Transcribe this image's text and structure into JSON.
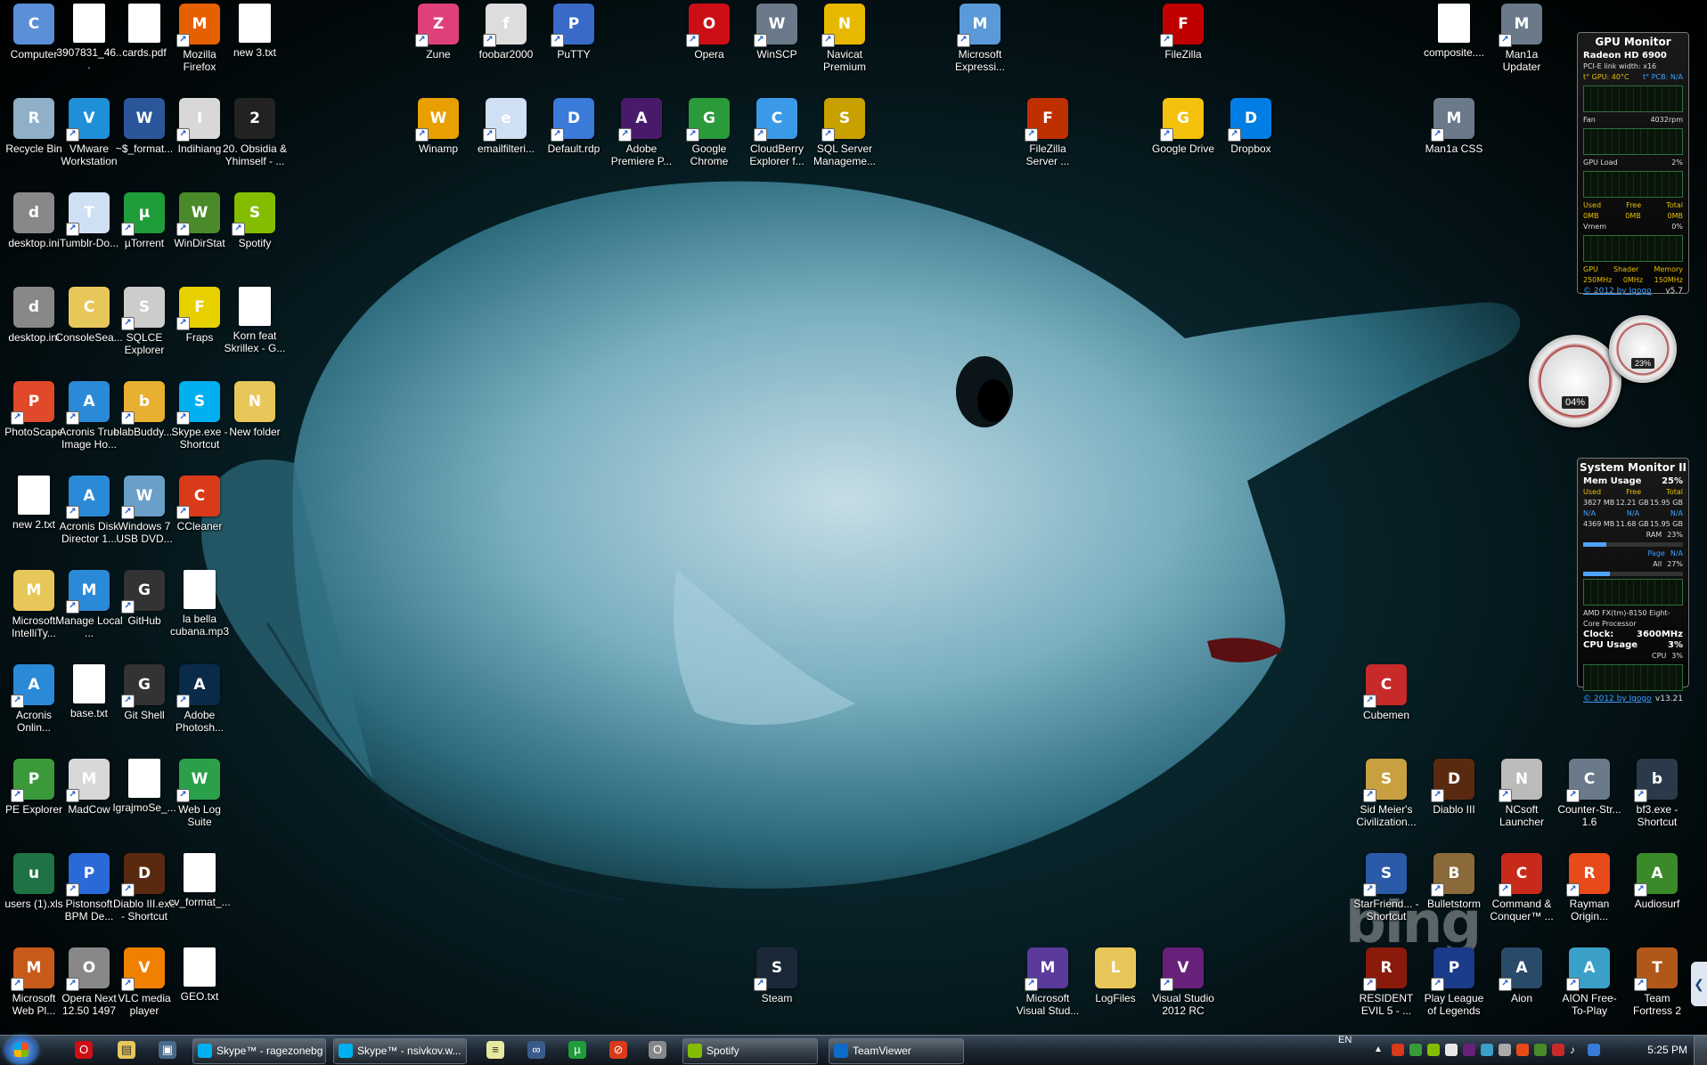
{
  "desktop_icons": [
    {
      "label": "Computer",
      "icon": "computer-icon",
      "color": "#5b8fd8",
      "shortcut": false
    },
    {
      "label": "3907831_46...",
      "icon": "file-icon",
      "color": "#ffffff",
      "shortcut": false
    },
    {
      "label": "cards.pdf",
      "icon": "pdf-icon",
      "color": "#ffffff",
      "shortcut": false
    },
    {
      "label": "Mozilla Firefox",
      "icon": "firefox-icon",
      "color": "#e66000",
      "shortcut": true
    },
    {
      "label": "new 3.txt",
      "icon": "text-file-icon",
      "color": "#ffffff",
      "shortcut": false
    },
    {
      "label": "Recycle Bin",
      "icon": "recycle-bin-icon",
      "color": "#8fb0c8",
      "shortcut": false
    },
    {
      "label": "VMware Workstation",
      "icon": "vmware-icon",
      "color": "#1f8fd8",
      "shortcut": true
    },
    {
      "label": "~$_format...",
      "icon": "word-doc-icon",
      "color": "#2b579a",
      "shortcut": false
    },
    {
      "label": "Indihiang",
      "icon": "chart-app-icon",
      "color": "#d8d8d8",
      "shortcut": true
    },
    {
      "label": "20. Obsidia & Yhimself - ...",
      "icon": "image-file-icon",
      "color": "#222222",
      "shortcut": false
    },
    {
      "label": "desktop.ini",
      "icon": "settings-file-icon",
      "color": "#888888",
      "shortcut": false
    },
    {
      "label": "Tumblr-Do...",
      "icon": "window-app-icon",
      "color": "#cfe0f5",
      "shortcut": true
    },
    {
      "label": "µTorrent",
      "icon": "utorrent-icon",
      "color": "#1f9d3a",
      "shortcut": true
    },
    {
      "label": "WinDirStat",
      "icon": "tree-icon",
      "color": "#4a8a2a",
      "shortcut": true
    },
    {
      "label": "Spotify",
      "icon": "spotify-icon",
      "color": "#84bd00",
      "shortcut": true
    },
    {
      "label": "desktop.ini",
      "icon": "settings-file-icon",
      "color": "#888888",
      "shortcut": false
    },
    {
      "label": "ConsoleSea...",
      "icon": "folder-icon",
      "color": "#e8c75a",
      "shortcut": false
    },
    {
      "label": "SQLCE Explorer",
      "icon": "database-icon",
      "color": "#cccccc",
      "shortcut": true
    },
    {
      "label": "Fraps",
      "icon": "fraps-icon",
      "color": "#e8d000",
      "shortcut": true
    },
    {
      "label": "Korn feat Skrillex - G...",
      "icon": "mp3-file-icon",
      "color": "#ffffff",
      "shortcut": false
    },
    {
      "label": "PhotoScape",
      "icon": "photoscape-icon",
      "color": "#e04a2a",
      "shortcut": true
    },
    {
      "label": "Acronis True Image Ho...",
      "icon": "acronis-icon",
      "color": "#2a8ad8",
      "shortcut": true
    },
    {
      "label": "blabBuddy....",
      "icon": "app-icon",
      "color": "#e8b030",
      "shortcut": true
    },
    {
      "label": "Skype.exe - Shortcut",
      "icon": "skype-icon",
      "color": "#00aff0",
      "shortcut": true
    },
    {
      "label": "New folder",
      "icon": "folder-icon",
      "color": "#e8c75a",
      "shortcut": false
    },
    {
      "label": "new 2.txt",
      "icon": "text-file-icon",
      "color": "#ffffff",
      "shortcut": false
    },
    {
      "label": "Acronis Disk Director 1...",
      "icon": "acronis-icon",
      "color": "#2a8ad8",
      "shortcut": true
    },
    {
      "label": "Windows 7 USB DVD...",
      "icon": "usb-tool-icon",
      "color": "#6aa0c8",
      "shortcut": true
    },
    {
      "label": "CCleaner",
      "icon": "ccleaner-icon",
      "color": "#d83a1a",
      "shortcut": true
    },
    {
      "label": "Microsoft IntelliTy...",
      "icon": "folder-icon",
      "color": "#e8c75a",
      "shortcut": false
    },
    {
      "label": "Manage Local ...",
      "icon": "acronis-icon",
      "color": "#2a8ad8",
      "shortcut": true
    },
    {
      "label": "GitHub",
      "icon": "github-icon",
      "color": "#333333",
      "shortcut": true
    },
    {
      "label": "la bella cubana.mp3",
      "icon": "mp3-file-icon",
      "color": "#ffffff",
      "shortcut": false
    },
    {
      "label": "Acronis Onlin...",
      "icon": "acronis-icon",
      "color": "#2a8ad8",
      "shortcut": true
    },
    {
      "label": "base.txt",
      "icon": "text-file-icon",
      "color": "#ffffff",
      "shortcut": false
    },
    {
      "label": "Git Shell",
      "icon": "github-icon",
      "color": "#333333",
      "shortcut": true
    },
    {
      "label": "Adobe Photosh...",
      "icon": "photoshop-icon",
      "color": "#0a2a4a",
      "shortcut": true
    },
    {
      "label": "PE Explorer",
      "icon": "pe-explorer-icon",
      "color": "#3a9a3a",
      "shortcut": true
    },
    {
      "label": "MadCow",
      "icon": "app-window-icon",
      "color": "#d8d8d8",
      "shortcut": true
    },
    {
      "label": "IgrajmoSe_...",
      "icon": "image-file-icon",
      "color": "#ffffff",
      "shortcut": false
    },
    {
      "label": "Web Log Suite",
      "icon": "web-log-icon",
      "color": "#2aa04a",
      "shortcut": true
    },
    {
      "label": "users (1).xls",
      "icon": "excel-file-icon",
      "color": "#1f7244",
      "shortcut": false
    },
    {
      "label": "Pistonsoft BPM De...",
      "icon": "bpm-icon",
      "color": "#2a6ad8",
      "shortcut": true
    },
    {
      "label": "Diablo III.exe - Shortcut",
      "icon": "diablo-icon",
      "color": "#5a2a10",
      "shortcut": true
    },
    {
      "label": "cv_format_...",
      "icon": "pdf-icon",
      "color": "#ffffff",
      "shortcut": false
    },
    {
      "label": "Microsoft Web Pl...",
      "icon": "web-platform-icon",
      "color": "#c85a1a",
      "shortcut": true
    },
    {
      "label": "Opera Next 12.50 1497",
      "icon": "opera-next-icon",
      "color": "#888888",
      "shortcut": true
    },
    {
      "label": "VLC media player",
      "icon": "vlc-icon",
      "color": "#f08000",
      "shortcut": true
    },
    {
      "label": "GEO.txt",
      "icon": "text-file-icon",
      "color": "#ffffff",
      "shortcut": false
    },
    {
      "label": "Zune",
      "icon": "zune-icon",
      "color": "#e0407a",
      "shortcut": true
    },
    {
      "label": "foobar2000",
      "icon": "foobar-icon",
      "color": "#dddddd",
      "shortcut": true
    },
    {
      "label": "PuTTY",
      "icon": "putty-icon",
      "color": "#3a6ac8",
      "shortcut": true
    },
    {
      "label": "Opera",
      "icon": "opera-icon",
      "color": "#cc0f16",
      "shortcut": true
    },
    {
      "label": "WinSCP",
      "icon": "winscp-icon",
      "color": "#6a7a8a",
      "shortcut": true
    },
    {
      "label": "Navicat Premium",
      "icon": "navicat-icon",
      "color": "#e8b800",
      "shortcut": true
    },
    {
      "label": "Microsoft Expressi...",
      "icon": "expression-icon",
      "color": "#5a9ad8",
      "shortcut": true
    },
    {
      "label": "FileZilla",
      "icon": "filezilla-icon",
      "color": "#bf0000",
      "shortcut": true
    },
    {
      "label": "composite....",
      "icon": "text-file-icon",
      "color": "#ffffff",
      "shortcut": false
    },
    {
      "label": "Man1a Updater",
      "icon": "counter-strike-icon",
      "color": "#6a7a8a",
      "shortcut": true
    },
    {
      "label": "Winamp",
      "icon": "winamp-icon",
      "color": "#e8a000",
      "shortcut": true
    },
    {
      "label": "emailfilteri...",
      "icon": "window-app-icon",
      "color": "#cfe0f5",
      "shortcut": true
    },
    {
      "label": "Default.rdp",
      "icon": "remote-desktop-icon",
      "color": "#3a7ad8",
      "shortcut": true
    },
    {
      "label": "Adobe Premiere P...",
      "icon": "premiere-icon",
      "color": "#4a1a6a",
      "shortcut": true
    },
    {
      "label": "Google Chrome",
      "icon": "chrome-icon",
      "color": "#2a9a3a",
      "shortcut": true
    },
    {
      "label": "CloudBerry Explorer f...",
      "icon": "cloudberry-icon",
      "color": "#3a9ae8",
      "shortcut": true
    },
    {
      "label": "SQL Server Manageme...",
      "icon": "sql-server-icon",
      "color": "#c8a000",
      "shortcut": true
    },
    {
      "label": "FileZilla Server ...",
      "icon": "filezilla-server-icon",
      "color": "#bf3000",
      "shortcut": true
    },
    {
      "label": "Google Drive",
      "icon": "google-drive-icon",
      "color": "#f4c20d",
      "shortcut": true
    },
    {
      "label": "Dropbox",
      "icon": "dropbox-icon",
      "color": "#007ee5",
      "shortcut": true
    },
    {
      "label": "Man1a CSS",
      "icon": "counter-strike-icon",
      "color": "#6a7a8a",
      "shortcut": true
    },
    {
      "label": "Cubemen",
      "icon": "cubemen-icon",
      "color": "#c82a2a",
      "shortcut": true
    },
    {
      "label": "Sid Meier's Civilization...",
      "icon": "civilization-icon",
      "color": "#c8a040",
      "shortcut": true
    },
    {
      "label": "Diablo III",
      "icon": "diablo-icon",
      "color": "#5a2a10",
      "shortcut": true
    },
    {
      "label": "NCsoft Launcher",
      "icon": "ncsoft-icon",
      "color": "#bbbbbb",
      "shortcut": true
    },
    {
      "label": "Counter-Str... 1.6",
      "icon": "counter-strike-icon",
      "color": "#6a7a8a",
      "shortcut": true
    },
    {
      "label": "bf3.exe - Shortcut",
      "icon": "battlefield-icon",
      "color": "#2a3a4a",
      "shortcut": true
    },
    {
      "label": "StarFriend... - Shortcut",
      "icon": "starfriend-icon",
      "color": "#2a5aa8",
      "shortcut": true
    },
    {
      "label": "Bulletstorm",
      "icon": "bulletstorm-icon",
      "color": "#8a6a3a",
      "shortcut": true
    },
    {
      "label": "Command & Conquer™ ...",
      "icon": "command-conquer-icon",
      "color": "#c82a1a",
      "shortcut": true
    },
    {
      "label": "Rayman Origin...",
      "icon": "rayman-icon",
      "color": "#e84a1a",
      "shortcut": true
    },
    {
      "label": "Audiosurf",
      "icon": "audiosurf-icon",
      "color": "#3a8a2a",
      "shortcut": true
    },
    {
      "label": "Steam",
      "icon": "steam-icon",
      "color": "#1b2838",
      "shortcut": true
    },
    {
      "label": "Microsoft Visual Stud...",
      "icon": "visual-studio-icon",
      "color": "#5a3a9a",
      "shortcut": true
    },
    {
      "label": "LogFiles",
      "icon": "folder-icon",
      "color": "#e8c75a",
      "shortcut": false
    },
    {
      "label": "Visual Studio 2012 RC",
      "icon": "visual-studio-icon",
      "color": "#68217a",
      "shortcut": true
    },
    {
      "label": "RESIDENT EVIL 5 - ...",
      "icon": "resident-evil-icon",
      "color": "#8a1a0a",
      "shortcut": true
    },
    {
      "label": "Play League of Legends",
      "icon": "league-icon",
      "color": "#1a3a8a",
      "shortcut": true
    },
    {
      "label": "Aion",
      "icon": "aion-icon",
      "color": "#2a4a6a",
      "shortcut": true
    },
    {
      "label": "AION Free-To-Play",
      "icon": "aion-icon",
      "color": "#3aa0c8",
      "shortcut": true
    },
    {
      "label": "Team Fortress 2",
      "icon": "tf2-icon",
      "color": "#b0581a",
      "shortcut": true
    }
  ],
  "gpu_monitor": {
    "title": "GPU Monitor",
    "card": "Radeon HD 6900",
    "pci": "PCI-E link width: x16",
    "temp_gpu": "t° GPU: 40°C",
    "temp_pcb": "t° PCB: N/A",
    "fan_label": "Fan",
    "fan_value": "4032rpm",
    "gpu_load_label": "GPU Load",
    "gpu_load_value": "2%",
    "mem_used_label": "Used",
    "mem_free_label": "Free",
    "mem_total_label": "Total",
    "mem_used": "0MB",
    "mem_free": "0MB",
    "mem_total": "0MB",
    "vmem_label": "Vmem",
    "vmem_value": "0%",
    "clock_gpu_label": "GPU",
    "clock_shader_label": "Shader",
    "clock_memory_label": "Memory",
    "clock_gpu": "250MHz",
    "clock_shader": "0MHz",
    "clock_memory": "150MHz",
    "link": "© 2012 by Igogo",
    "version": "v5.7"
  },
  "gauges": {
    "cpu_label": "04%",
    "mem_label": "23%"
  },
  "system_monitor": {
    "title": "System Monitor II",
    "mem_usage_label": "Mem Usage",
    "mem_usage_value": "25%",
    "col_used": "Used",
    "col_free": "Free",
    "col_total": "Total",
    "row1": [
      "3827 MB",
      "12.21 GB",
      "15.95 GB"
    ],
    "row2": [
      "N/A",
      "N/A",
      "N/A"
    ],
    "row3": [
      "4369 MB",
      "11.68 GB",
      "15.95 GB"
    ],
    "ram_label": "RAM",
    "ram_value": "23%",
    "page_label": "Page",
    "page_value": "N/A",
    "all_label": "All",
    "all_value": "27%",
    "cpu_name": "AMD FX(tm)-8150 Eight-Core Processor",
    "clock_label": "Clock:",
    "clock_value": "3600MHz",
    "cpu_usage_label": "CPU Usage",
    "cpu_usage_value": "3%",
    "cpu_label": "CPU",
    "cpu_value": "3%",
    "link": "© 2012 by Igogo",
    "version": "v13.21"
  },
  "watermark": "bing",
  "taskbar": {
    "windows": [
      {
        "label": "Skype™ - ragezonebg",
        "color": "#00aff0"
      },
      {
        "label": "Skype™ - nsivkov.w...",
        "color": "#00aff0"
      },
      {
        "label": "Spotify",
        "color": "#84bd00"
      },
      {
        "label": "TeamViewer",
        "color": "#0e6ac8"
      }
    ],
    "lang": "EN",
    "clock": "5:25 PM"
  }
}
